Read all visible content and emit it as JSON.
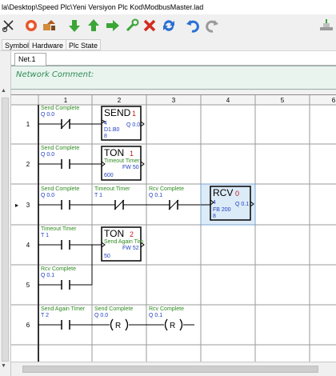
{
  "window": {
    "title": "la\\Desktop\\Speed Plc\\Yeni Versiyon Plc Kod\\ModbusMaster.lad"
  },
  "side_tabs": [
    "Symbol",
    "Hardware",
    "Plc State"
  ],
  "network_tab": "Net.1",
  "network_comment": "Network Comment:",
  "columns": [
    "1",
    "2",
    "3",
    "4",
    "5",
    "6"
  ],
  "rows": [
    "1",
    "2",
    "3",
    "4",
    "5",
    "6"
  ],
  "current_row_marker": "▸",
  "colors": {
    "symbol_green": "#2e8b1f",
    "address_blue": "#1f3fbf",
    "block_red": "#c0201e",
    "highlight": "#dcebf8",
    "grid": "#9a9a9a",
    "comment_bg": "#e9f4ee"
  },
  "icons": [
    "scissors-icon",
    "stop-icon",
    "flow-icon",
    "arrow-down-icon",
    "arrow-up-icon",
    "arrow-right-icon",
    "tools-icon",
    "delete-icon",
    "refresh-icon",
    "undo-icon",
    "redo-icon"
  ],
  "rungs": {
    "r1": {
      "c1_sym": "Send Complete",
      "c1_addr": "Q 0.0",
      "block": {
        "name": "SEND",
        "num": "1",
        "in1": "4",
        "in2": "D1.B0",
        "in3": "8",
        "out": "Q 0.0"
      }
    },
    "r2": {
      "c1_sym": "Send Complete",
      "c1_addr": "Q 0.0",
      "block": {
        "name": "TON",
        "num": "1",
        "sym": "Timeout Timer",
        "fw": "FW 50",
        "in": "600"
      }
    },
    "r3": {
      "c1_sym": "Send Complete",
      "c1_addr": "Q 0.0",
      "c2_sym": "Timeout Timer",
      "c2_addr": "T 1",
      "c3_sym": "Rcv Complete",
      "c3_addr": "Q 0.1",
      "block": {
        "name": "RCV",
        "num": "0",
        "in1": "4",
        "in2": "FB 200",
        "in3": "8",
        "out": "Q 0.1"
      }
    },
    "r4": {
      "c1_sym": "Timeout Timer",
      "c1_addr": "T 1",
      "block": {
        "name": "TON",
        "num": "2",
        "sym": "Send Again Tim",
        "fw": "FW 52",
        "in": "50"
      }
    },
    "r5": {
      "c1_sym": "Rcv Complete",
      "c1_addr": "Q 0.1"
    },
    "r6": {
      "c1_sym": "Send Again Timer",
      "c1_addr": "T 2",
      "c2_sym": "Send Complete",
      "c2_addr": "Q 0.0",
      "c2_coil": "R",
      "c3_sym": "Rcv Complete",
      "c3_addr": "Q 0.1",
      "c3_coil": "R"
    }
  }
}
